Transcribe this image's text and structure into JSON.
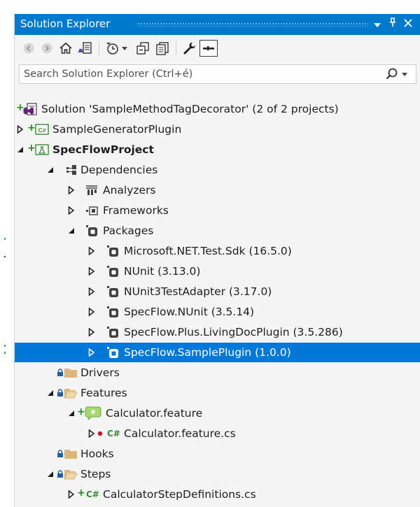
{
  "window": {
    "title": "Solution Explorer",
    "title_buttons": [
      "dropdown",
      "pin",
      "close"
    ]
  },
  "toolbar": {
    "buttons": [
      "back-icon",
      "forward-icon",
      "home-icon",
      "switch-views-icon",
      "pending-changes-filter-icon",
      "collapse-all-icon",
      "show-all-files-icon",
      "properties-icon",
      "preview-selected-items-icon"
    ]
  },
  "search": {
    "placeholder": "Search Solution Explorer (Ctrl+é)",
    "value": ""
  },
  "tree": {
    "solution": "Solution 'SampleMethodTagDecorator' (2 of 2 projects)",
    "generator_plugin": "SampleGeneratorPlugin",
    "project": "SpecFlowProject",
    "dependencies": "Dependencies",
    "analyzers": "Analyzers",
    "frameworks": "Frameworks",
    "packages": "Packages",
    "package_items": [
      "Microsoft.NET.Test.Sdk (16.5.0)",
      "NUnit (3.13.0)",
      "NUnit3TestAdapter (3.17.0)",
      "SpecFlow.NUnit (3.5.14)",
      "SpecFlow.Plus.LivingDocPlugin (3.5.286)",
      "SpecFlow.SamplePlugin (1.0.0)"
    ],
    "drivers": "Drivers",
    "features": "Features",
    "calculator_feature": "Calculator.feature",
    "calculator_feature_cs": "Calculator.feature.cs",
    "hooks": "Hooks",
    "steps": "Steps",
    "step_definitions": "CalculatorStepDefinitions.cs",
    "selected_item": "SpecFlow.SamplePlugin (1.0.0)",
    "cs_badge": "C#"
  },
  "colors": {
    "accent": "#007acc",
    "selection": "#0078d7",
    "added_green": "#1a8a1a",
    "folder": "#dcb67a"
  }
}
